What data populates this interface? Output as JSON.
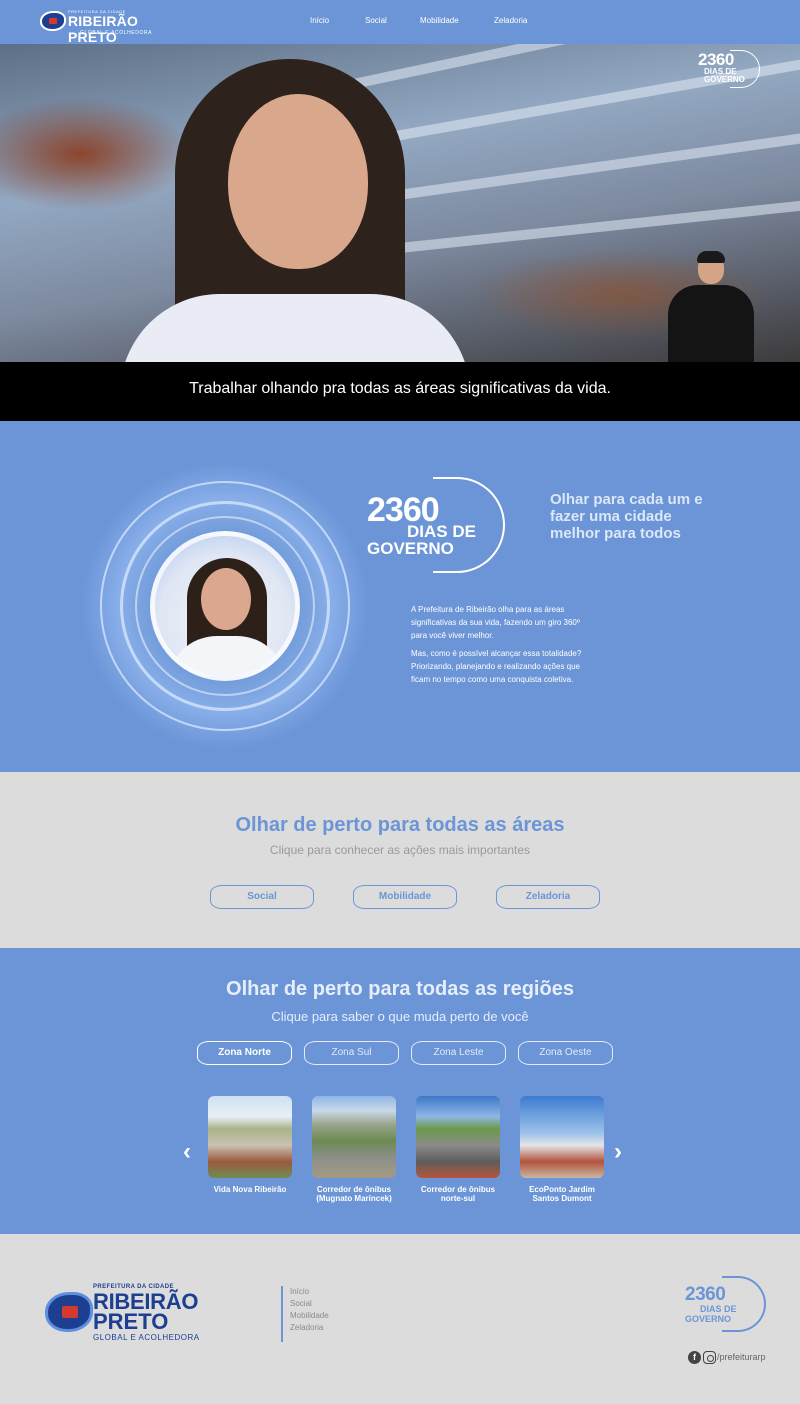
{
  "header": {
    "logo": {
      "prefix": "PREFEITURA DA CIDADE",
      "name": "RIBEIRÃO PRETO",
      "tagline": "GLOBAL E ACOLHEDORA"
    },
    "nav": [
      {
        "label": "Início"
      },
      {
        "label": "Social"
      },
      {
        "label": "Mobilidade"
      },
      {
        "label": "Zeladoria"
      }
    ]
  },
  "hero": {
    "badge": {
      "number": "2360",
      "label": "DIAS DE GOVERNO"
    },
    "caption": "Trabalhar olhando pra todas as áreas significativas da vida."
  },
  "about": {
    "badge": {
      "number": "2360",
      "line1": "DIAS DE",
      "line2": "GOVERNO"
    },
    "tagline": "Olhar para cada um e fazer uma cidade melhor para todos",
    "paragraph1": "A Prefeitura de Ribeirão olha para as áreas significativas da sua vida, fazendo um giro 360º para você viver melhor.",
    "paragraph2": "Mas, como é possível alcançar essa totalidade? Priorizando, planejando e realizando ações que ficam no tempo como uma conquista coletiva."
  },
  "areas": {
    "title": "Olhar de perto para todas as áreas",
    "subtitle": "Clique para conhecer as ações mais importantes",
    "buttons": [
      {
        "label": "Social"
      },
      {
        "label": "Mobilidade"
      },
      {
        "label": "Zeladoria"
      }
    ]
  },
  "regions": {
    "title": "Olhar de perto para todas as regiões",
    "subtitle": "Clique para saber o que muda perto de você",
    "zones": [
      {
        "label": "Zona Norte",
        "active": true
      },
      {
        "label": "Zona Sul",
        "active": false
      },
      {
        "label": "Zona Leste",
        "active": false
      },
      {
        "label": "Zona Oeste",
        "active": false
      }
    ],
    "cards": [
      {
        "label": "Vida Nova Ribeirão"
      },
      {
        "label": "Corredor de ônibus (Mugnato Marincek)"
      },
      {
        "label": "Corredor de ônibus norte-sul"
      },
      {
        "label": "EcoPonto Jardim Santos Dumont"
      }
    ],
    "prev_icon": "chevron-left-icon",
    "next_icon": "chevron-right-icon"
  },
  "footer": {
    "logo": {
      "prefix": "PREFEITURA DA CIDADE",
      "line1": "RIBEIRÃO",
      "line2": "PRETO",
      "tagline": "GLOBAL E ACOLHEDORA"
    },
    "nav": [
      {
        "label": "Início"
      },
      {
        "label": "Social"
      },
      {
        "label": "Mobilidade"
      },
      {
        "label": "Zeladoria"
      }
    ],
    "badge": {
      "number": "2360",
      "line1": "DIAS DE",
      "line2": "GOVERNO"
    },
    "social": {
      "icons": [
        "facebook-icon",
        "instagram-icon"
      ],
      "handle": "/prefeiturarp"
    }
  },
  "colors": {
    "primary": "#6b95d6",
    "dark_blue": "#1c3f92",
    "light_bg": "#dcdcdc"
  }
}
